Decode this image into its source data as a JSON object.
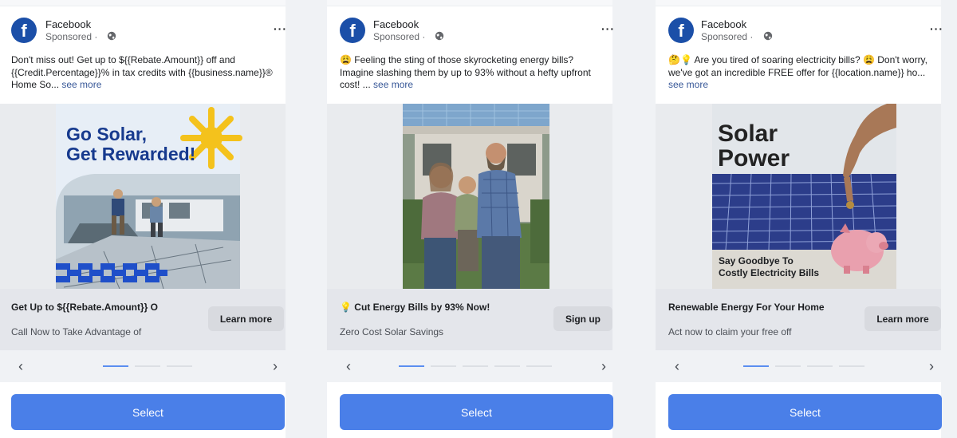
{
  "cards": [
    {
      "page_name": "Facebook",
      "sponsored": "Sponsored",
      "dot": "·",
      "more": "···",
      "body": "Don't miss out! Get up to ${{Rebate.Amount}} off and {{Credit.Percentage}}% in tax credits with {{business.name}}® Home So...",
      "see_more": "see more",
      "image": {
        "line1": "Go Solar,",
        "line2": "Get Rewarded!"
      },
      "headline": "Get Up to ${{Rebate.Amount}} O",
      "description": "Call Now to Take Advantage of",
      "cta": "Learn more",
      "prev": "‹",
      "next": "›",
      "dots_total": 3,
      "active_dot": 0,
      "select": "Select"
    },
    {
      "page_name": "Facebook",
      "sponsored": "Sponsored",
      "dot": "·",
      "more": "···",
      "body": "😩 Feeling the sting of those skyrocketing energy bills? Imagine slashing them by up to 93% without a hefty upfront cost! ...",
      "see_more": "see more",
      "headline": "💡 Cut Energy Bills by 93% Now!",
      "description": "Zero Cost Solar Savings",
      "cta": "Sign up",
      "prev": "‹",
      "next": "›",
      "dots_total": 5,
      "active_dot": 0,
      "select": "Select"
    },
    {
      "page_name": "Facebook",
      "sponsored": "Sponsored",
      "dot": "·",
      "more": "···",
      "body": "🤔💡 Are you tired of soaring electricity bills? 😩 Don't worry, we've got an incredible FREE offer for {{location.name}} ho...",
      "see_more": "see more",
      "image": {
        "line1": "Solar",
        "line2": "Power",
        "caption1": "Say Goodbye To",
        "caption2": "Costly Electricity Bills"
      },
      "headline": "Renewable Energy For Your Home",
      "description": "Act now to claim your free off",
      "cta": "Learn more",
      "prev": "‹",
      "next": "›",
      "dots_total": 4,
      "active_dot": 0,
      "select": "Select"
    }
  ],
  "colors": {
    "accent": "#4a7fe8",
    "brand": "#1b4fa8",
    "link": "#385898"
  }
}
